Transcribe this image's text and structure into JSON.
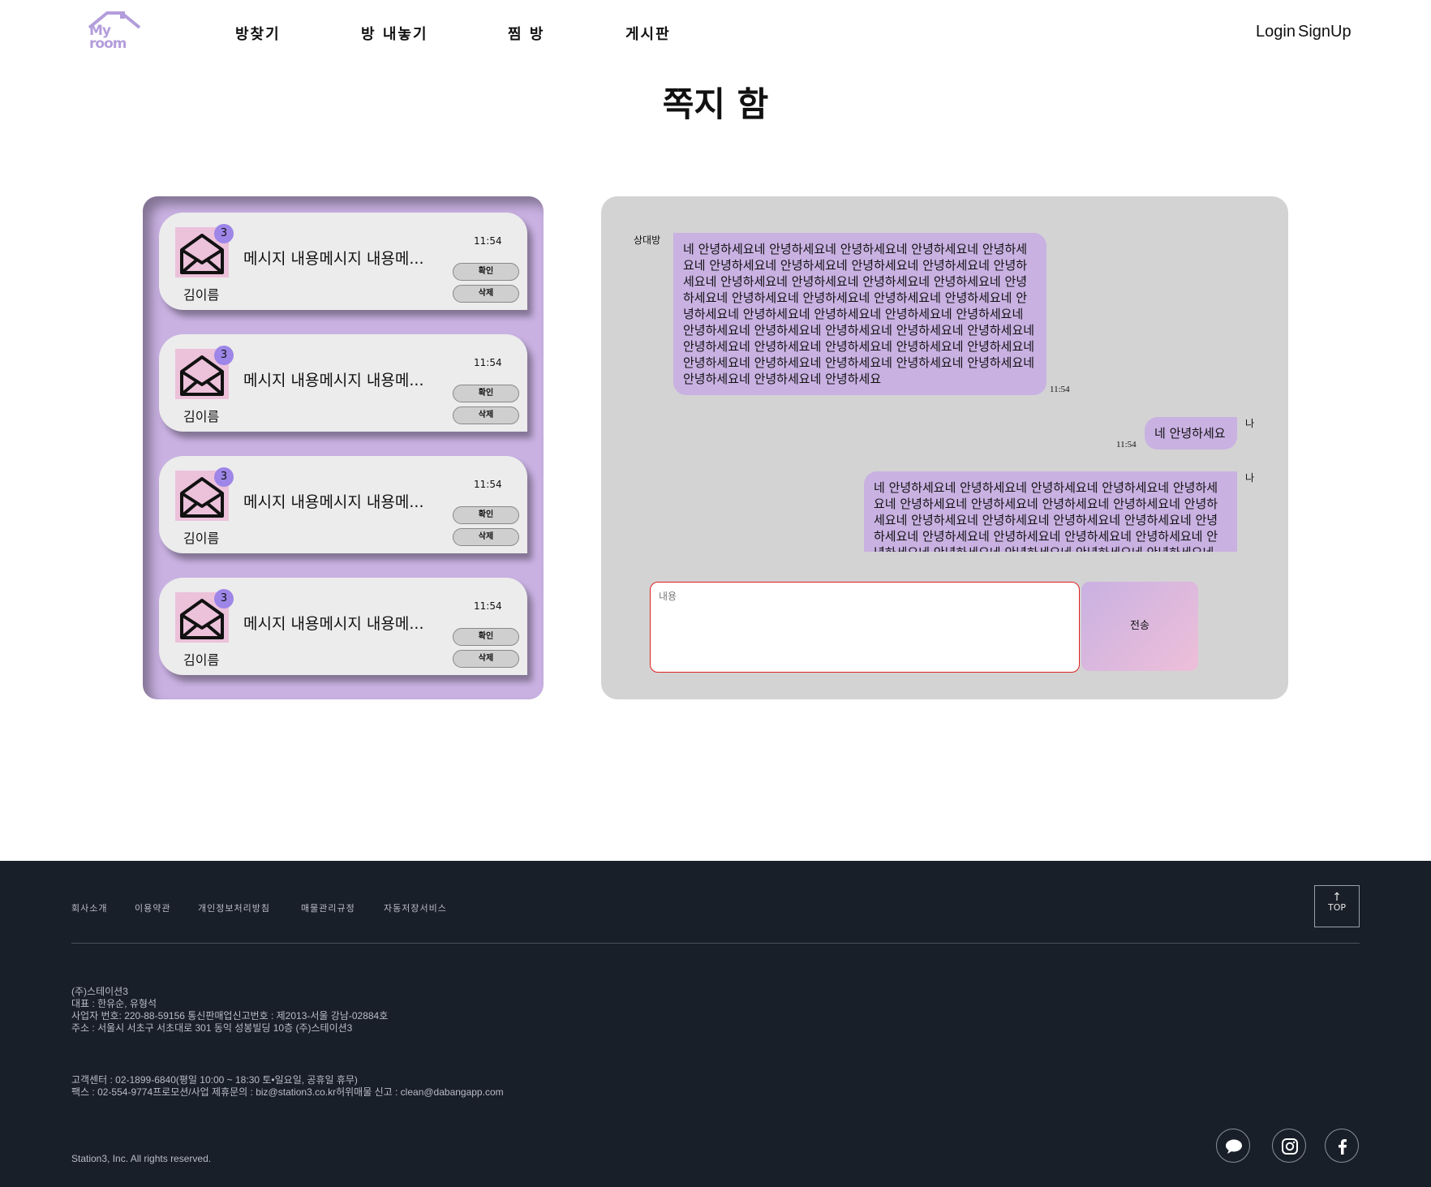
{
  "header": {
    "logo_text_line1": "My",
    "logo_text_line2": "room",
    "nav": [
      "방찾기",
      "방 내놓기",
      "찜 방",
      "게시판"
    ],
    "login": "Login",
    "signup": "SignUp"
  },
  "page_title": "쪽지 함",
  "messages": [
    {
      "badge": "3",
      "sender": "김이름",
      "preview": "메시지 내용메시지 내용메...",
      "time": "11:54",
      "confirm": "확인",
      "delete": "삭제"
    },
    {
      "badge": "3",
      "sender": "김이름",
      "preview": "메시지 내용메시지 내용메...",
      "time": "11:54",
      "confirm": "확인",
      "delete": "삭제"
    },
    {
      "badge": "3",
      "sender": "김이름",
      "preview": "메시지 내용메시지 내용메...",
      "time": "11:54",
      "confirm": "확인",
      "delete": "삭제"
    },
    {
      "badge": "3",
      "sender": "김이름",
      "preview": "메시지 내용메시지 내용메...",
      "time": "11:54",
      "confirm": "확인",
      "delete": "삭제"
    }
  ],
  "chat": {
    "conversation": [
      {
        "who": "상대방",
        "text": "네 안녕하세요네 안녕하세요네 안녕하세요네 안녕하세요네 안녕하세요네 안녕하세요네 안녕하세요네 안녕하세요네 안녕하세요네 안녕하세요네 안녕하세요네 안녕하세요네 안녕하세요네 안녕하세요네 안녕하세요네 안녕하세요네 안녕하세요네 안녕하세요네 안녕하세요네 안녕하세요네 안녕하세요네 안녕하세요네 안녕하세요네 안녕하세요네 안녕하세요네 안녕하세요네 안녕하세요네 안녕하세요네 안녕하세요네 안녕하세요네 안녕하세요네 안녕하세요네 안녕하세요네 안녕하세요네 안녕하세요네 안녕하세요네 안녕하세요네 안녕하세요네 안녕하세요네 안녕하세요네 안녕하세요네 안녕하세요",
        "time": "11:54"
      },
      {
        "who": "나",
        "text": "네 안녕하세요",
        "time": "11:54"
      },
      {
        "who": "나",
        "text": "네 안녕하세요네 안녕하세요네 안녕하세요네 안녕하세요네 안녕하세요네 안녕하세요네 안녕하세요네 안녕하세요네 안녕하세요네 안녕하세요네 안녕하세요네 안녕하세요네 안녕하세요네 안녕하세요네 안녕하세요네 안녕하세요네 안녕하세요네 안녕하세요네 안녕하세요네 안녕하세요네 안녕하세요네 안녕하세요네 안녕하세요네 안녕하세요네 안녕하세요"
      }
    ],
    "input_placeholder": "내용",
    "send": "전송"
  },
  "footer": {
    "links": [
      "회사소개",
      "이용약관",
      "개인정보처리방침",
      "매물관리규정",
      "자동저장서비스"
    ],
    "top": "TOP",
    "company": "(주)스테이션3",
    "ceo": "대표 : 한유순, 유형석",
    "business": "사업자 번호: 220-88-59156  통신판매업신고번호 : 제2013-서울 강남-02884호",
    "address": "주소 : 서울시 서초구 서초대로 301 동익 성봉빌딩 10층 (주)스테이션3",
    "support": "고객센터 : 02-1899-6840(평일 10:00 ~ 18:30 토•일요일, 공휴일 휴무)",
    "contact": "팩스 : 02-554-9774프로모션/사업 제휴문의 : biz@station3.co.kr허위매물 신고 : clean@dabangapp.com",
    "copyright": "Station3, Inc. All rights reserved.",
    "social_icons": [
      "chat-icon",
      "instagram-icon",
      "facebook-icon"
    ]
  },
  "colors": {
    "accent_purple": "#c9b1e2",
    "badge_purple": "#9d86e8",
    "envelope_pink": "#ecc1da",
    "footer_bg": "#191f29",
    "chat_bg": "#d3d3d3"
  }
}
